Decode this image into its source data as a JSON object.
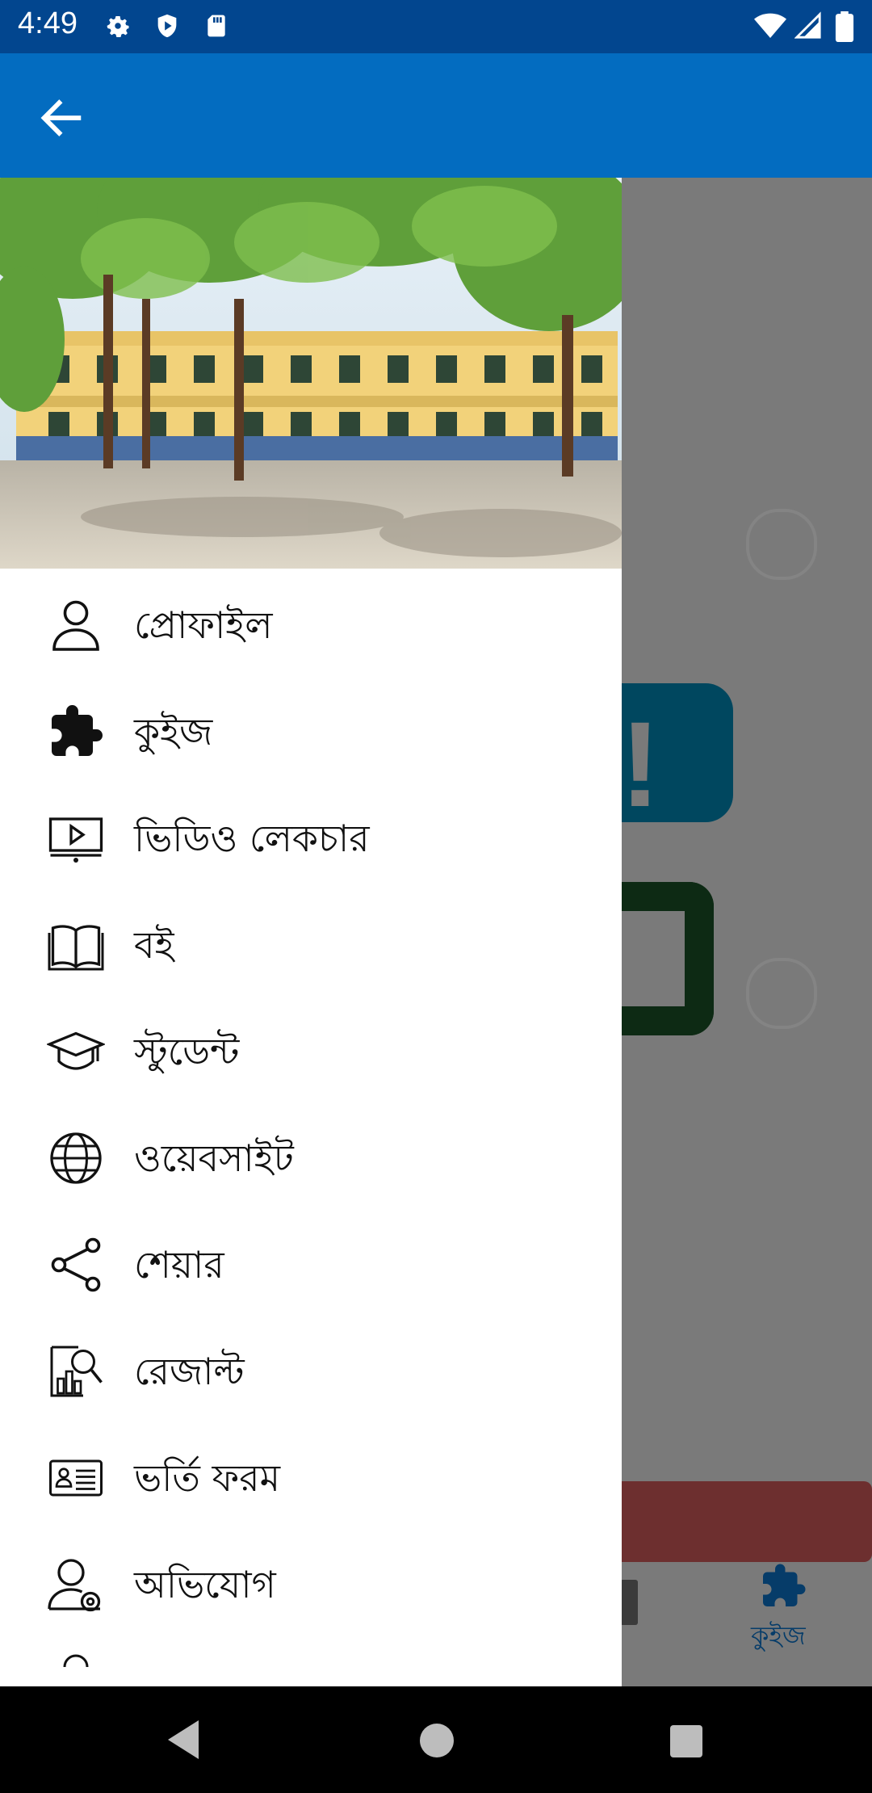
{
  "status_bar": {
    "time": "4:49",
    "icons": [
      "settings-icon",
      "shield-icon",
      "sd-card-icon",
      "wifi-icon",
      "signal-icon",
      "battery-icon"
    ]
  },
  "app_bar": {
    "back_icon": "arrow-left-icon",
    "color": "#036cc0"
  },
  "drawer": {
    "header_image": "school-building-photo",
    "items": [
      {
        "icon": "person-icon",
        "label": "প্রোফাইল"
      },
      {
        "icon": "puzzle-icon",
        "label": "কুইজ"
      },
      {
        "icon": "video-lecture-icon",
        "label": "ভিডিও লেকচার"
      },
      {
        "icon": "book-icon",
        "label": "বই"
      },
      {
        "icon": "graduation-cap-icon",
        "label": "স্টুডেন্ট"
      },
      {
        "icon": "globe-icon",
        "label": "ওয়েবসাইট"
      },
      {
        "icon": "share-icon",
        "label": "শেয়ার"
      },
      {
        "icon": "result-search-icon",
        "label": "রেজাল্ট"
      },
      {
        "icon": "id-card-icon",
        "label": "ভর্তি ফরম"
      },
      {
        "icon": "complaint-user-icon",
        "label": "অভিযোগ"
      }
    ]
  },
  "background_screen": {
    "bottom_nav_active_label": "কুইজ",
    "bottom_nav_active_icon": "puzzle-icon"
  },
  "nav_bar": {
    "back": "nav-back-icon",
    "home": "nav-home-icon",
    "recents": "nav-recents-icon"
  }
}
